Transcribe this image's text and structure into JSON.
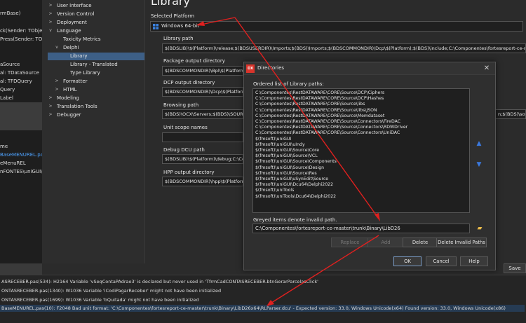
{
  "code_strip": {
    "lines": [
      {
        "text": "rmBase)",
        "hl": false
      },
      {
        "text": "ck(Sender: TObject)",
        "hl": false
      },
      {
        "text": "Press(Sender: TObje",
        "hl": false
      },
      {
        "text": "aSource",
        "hl": false
      },
      {
        "text": "al: TDataSource",
        "hl": false
      },
      {
        "text": "al: TFDQuery",
        "hl": false
      },
      {
        "text": "Query",
        "hl": false
      },
      {
        "text": "Label",
        "hl": false
      },
      {
        "text": "me",
        "hl": false
      },
      {
        "text": "BaseMENUREL.pas",
        "hl": true
      },
      {
        "text": "eMenuREL",
        "hl": false
      },
      {
        "text": "nFONTES\\uniGUI\\P",
        "hl": false
      }
    ]
  },
  "tree": {
    "items": [
      {
        "label": "User Interface",
        "chevron": ">"
      },
      {
        "label": "Version Control",
        "chevron": ">"
      },
      {
        "label": "Deployment",
        "chevron": ">"
      },
      {
        "label": "Language",
        "chevron": "v"
      },
      {
        "label": "Toxicity Metrics",
        "chevron": ""
      },
      {
        "label": "Delphi",
        "chevron": "v"
      },
      {
        "label": "Library",
        "chevron": ""
      },
      {
        "label": "Library - Translated",
        "chevron": ""
      },
      {
        "label": "Type Library",
        "chevron": ""
      },
      {
        "label": "Formatter",
        "chevron": ">"
      },
      {
        "label": "HTML",
        "chevron": ">"
      },
      {
        "label": "Modeling",
        "chevron": ">"
      },
      {
        "label": "Translation Tools",
        "chevron": ">"
      },
      {
        "label": "Debugger",
        "chevron": ">"
      }
    ]
  },
  "main": {
    "title": "Library",
    "selected_platform_label": "Selected Platform",
    "platform_value": "Windows 64-bit",
    "fields": [
      {
        "label": "Library path",
        "value": "$(BDSLIB)\\$(Platform)\\release;$(BDSUSERDIR)\\Imports;$(BDS)\\Imports;$(BDSCOMMONDIR)\\Dcp\\$(Platform);$(BDS)\\include;C:\\Componentes\\fortesreport-ce-master"
      },
      {
        "label": "Package output directory",
        "value": "$(BDSCOMMONDIR)\\Bpl\\$(Platform"
      },
      {
        "label": "DCP output directory",
        "value": "$(BDSCOMMONDIR)\\Dcp\\$(Platform"
      },
      {
        "label": "Browsing path",
        "value": "$(BDS)\\OCX\\Servers;$(BDS)\\SOURCE",
        "tail": "n;$(BDS)\\source"
      },
      {
        "label": "Unit scope names",
        "value": ""
      },
      {
        "label": "Debug DCU path",
        "value": "$(BDSLIB)\\$(Platform)\\debug;C:\\Co"
      },
      {
        "label": "HPP output directory",
        "value": "$(BDSCOMMONDIR)\\hpp\\$(Platform"
      }
    ],
    "save_label": "Save"
  },
  "dialog": {
    "title": "Directories",
    "list_label": "Ordered list of Library paths:",
    "paths": [
      "C:\\Componentes\\RestDATAWARE\\CORE\\Source\\DCP\\Ciphers",
      "C:\\Componentes\\RestDATAWARE\\CORE\\Source\\DCP\\Hashes",
      "C:\\Componentes\\RestDATAWARE\\CORE\\Source\\libs",
      "C:\\Componentes\\RestDATAWARE\\CORE\\Source\\libs\\JSON",
      "C:\\Componentes\\RestDATAWARE\\CORE\\Source\\Memdataset",
      "C:\\Componentes\\RestDATAWARE\\CORE\\Source\\Connectors\\FireDAC",
      "C:\\Componentes\\RestDATAWARE\\CORE\\Source\\Connectors\\RDWDriver",
      "C:\\Componentes\\RestDATAWARE\\CORE\\Source\\Connectors\\UniDAC",
      "$(fmsoft)\\uniGUI",
      "$(fmsoft)\\uniGUI\\uIndy",
      "$(fmsoft)\\uniGUI\\Source\\Core",
      "$(fmsoft)\\uniGUI\\Source\\VCL",
      "$(fmsoft)\\uniGUI\\Source\\Components",
      "$(fmsoft)\\uniGUI\\Source\\Design",
      "$(fmsoft)\\uniGUI\\Source\\Res",
      "$(fmsoft)\\uniGUI\\uSynEdit\\Source",
      "$(fmsoft)\\uniGUI\\Dcu64\\Delphi2022",
      "$(fmsoft)\\uniTools",
      "$(fmsoft)\\uniTools\\Dcu64\\Delphi2022"
    ],
    "invalid_label": "Greyed items denote invalid path.",
    "path_input": "C:\\Componentes\\fortesreport-ce-master\\trunk\\Binary\\LibD26",
    "replace_label": "Replace",
    "add_label": "Add",
    "delete_label": "Delete",
    "delete_invalid_label": "Delete Invalid Paths",
    "ok_label": "OK",
    "cancel_label": "Cancel",
    "help_label": "Help",
    "logo_text": "DX",
    "close_glyph": "✕",
    "folder_glyph": "▰",
    "up_glyph": "▲",
    "down_glyph": "▼"
  },
  "messages": [
    {
      "text": "ASRECEBER.pas(534): H2164 Variable 'vSeqContaPAdrao3' is declared but never used in 'TfrmCadCONTASRECEBER.btnGerarParcelasClick'",
      "hl": false
    },
    {
      "text": "ONTASRECEBER.pas(1340): W1036 Variable 'iCodiPagarReceber' might not have been initialized",
      "hl": false
    },
    {
      "text": "ONTASRECEBER.pas(1699): W1036 Variable 'bQuitada' might not have been initialized",
      "hl": false
    },
    {
      "text": "BaseMENUREL.pas(10): F2048 Bad unit format: 'C:\\Componentes\\fortesreport-ce-master\\trunk\\Binary\\LibD26x64\\RLParser.dcu' - Expected version: 33.0, Windows Unicode(x64) Found version: 33.0, Windows Unicode(x86)",
      "hl": true
    }
  ],
  "colors": {
    "accent": "#3d5f86",
    "arrow": "#e0201f",
    "error_highlight": "#263b53"
  }
}
